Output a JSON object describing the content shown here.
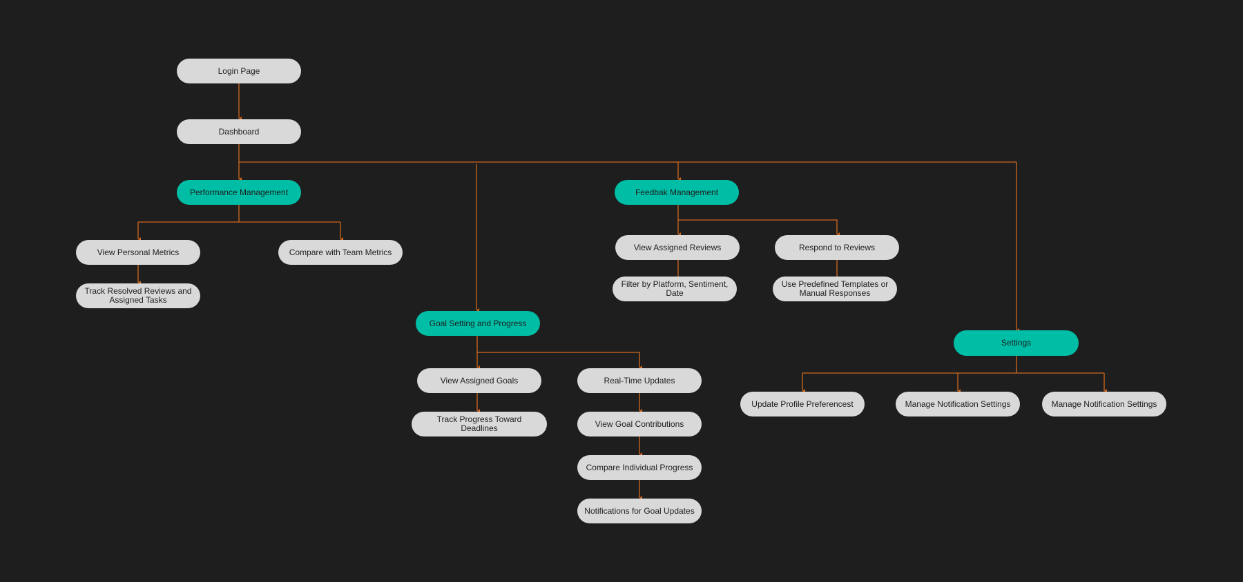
{
  "colors": {
    "background": "#1e1e1e",
    "page_node": "#d9d9d9",
    "section_node": "#00bda5",
    "connector": "#d2691e",
    "node_text": "#1e1e1e"
  },
  "nodes": {
    "login": "Login Page",
    "dashboard": "Dashboard",
    "performance": "Performance Management",
    "view_personal": "View Personal Metrics",
    "compare_team": "Compare with Team Metrics",
    "track_resolved": "Track Resolved Reviews and Assigned Tasks",
    "goal_setting": "Goal Setting and Progress",
    "view_goals": "View Assigned Goals",
    "track_progress": "Track Progress Toward Deadlines",
    "realtime": "Real-Time Updates",
    "goal_contrib": "View Goal Contributions",
    "compare_individual": "Compare Individual Progress",
    "goal_notifications": "Notifications for Goal Updates",
    "feedback": "Feedbak Management",
    "view_reviews": "View Assigned Reviews",
    "filter": "Filter by Platform, Sentiment, Date",
    "respond": "Respond to Reviews",
    "templates": "Use Predefined Templates or Manual Responses",
    "settings": "Settings",
    "update_profile": "Update Profile Preferencest",
    "manage_notif_1": "Manage Notification Settings",
    "manage_notif_2": "Manage Notification Settings"
  }
}
